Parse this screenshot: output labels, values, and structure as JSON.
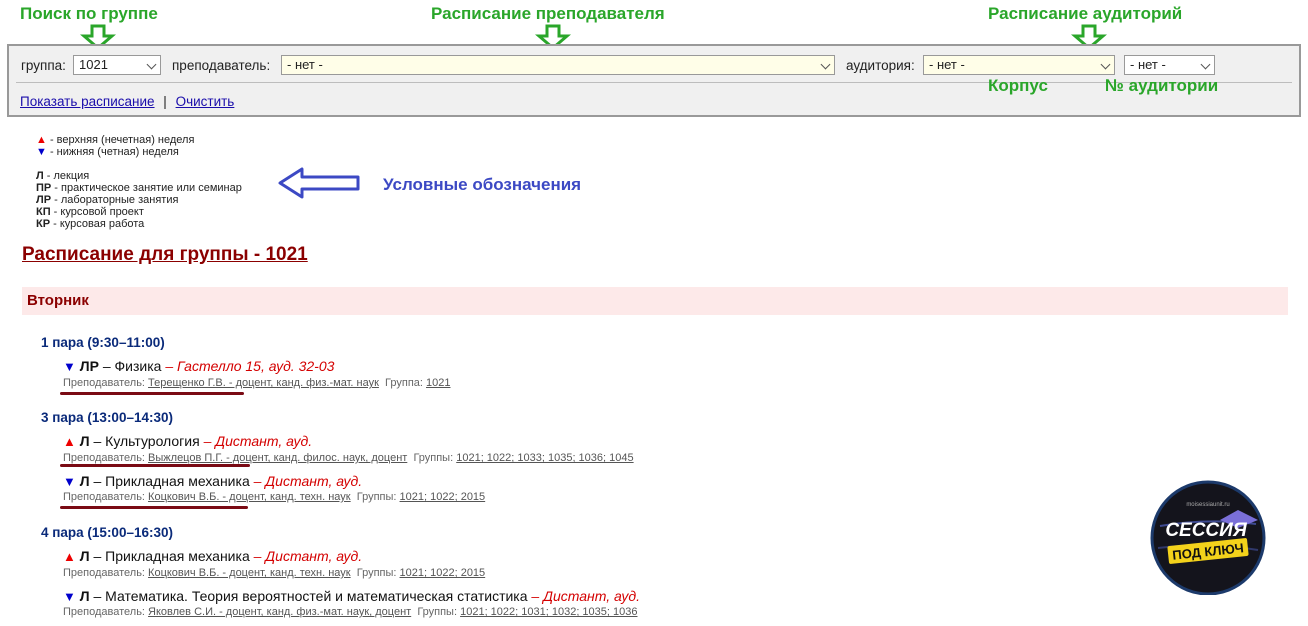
{
  "annotations": {
    "group_search": "Поиск по группе",
    "teacher_schedule": "Расписание преподавателя",
    "rooms_schedule": "Расписание аудиторий",
    "building": "Корпус",
    "room_number": "№ аудитории",
    "legend_note": "Условные обозначения"
  },
  "search": {
    "group_label": "группа:",
    "group_value": "1021",
    "teacher_label": "преподаватель:",
    "teacher_value": "- нет -",
    "room_label": "аудитория:",
    "building_value": "- нет -",
    "room_value": "- нет -",
    "show_link": "Показать расписание",
    "separator": "|",
    "clear_link": "Очистить"
  },
  "legend": {
    "upper_week": "- верхняя (нечетная) неделя",
    "lower_week": "- нижняя (четная) неделя",
    "types": [
      {
        "code": "Л",
        "text": " - лекция"
      },
      {
        "code": "ПР",
        "text": " - практическое занятие или семинар"
      },
      {
        "code": "ЛР",
        "text": " - лабораторные занятия"
      },
      {
        "code": "КП",
        "text": " - курсовой проект"
      },
      {
        "code": "КР",
        "text": " - курсовая работа"
      }
    ]
  },
  "schedule": {
    "title": "Расписание для группы - 1021",
    "day": "Вторник",
    "pairs": [
      {
        "label": "1 пара (9:30–11:00)"
      },
      {
        "label": "3 пара (13:00–14:30)"
      },
      {
        "label": "4 пара (15:00–16:30)"
      }
    ],
    "lessons": [
      {
        "week": "▼",
        "type": "ЛР",
        "subject": " – Физика ",
        "place": "– Гастелло 15, ауд. 32-03",
        "teacher_prefix": "Преподаватель: ",
        "teacher": "Терещенко Г.В. - доцент, канд. физ.-мат. наук",
        "groups_label": "Группа:",
        "groups": "1021"
      },
      {
        "week": "▲",
        "type": "Л",
        "subject": " – Культурология ",
        "place": "– Дистант, ауд.",
        "teacher_prefix": "Преподаватель: ",
        "teacher": "Выжлецов П.Г. - доцент, канд. филос. наук, доцент",
        "groups_label": "Группы:",
        "groups": "1021; 1022; 1033; 1035; 1036; 1045"
      },
      {
        "week": "▼",
        "type": "Л",
        "subject": " – Прикладная механика ",
        "place": "– Дистант, ауд.",
        "teacher_prefix": "Преподаватель: ",
        "teacher": "Коцкович В.Б. - доцент, канд. техн. наук",
        "groups_label": "Группы:",
        "groups": "1021; 1022; 2015"
      },
      {
        "week": "▲",
        "type": "Л",
        "subject": " – Прикладная механика ",
        "place": "– Дистант, ауд.",
        "teacher_prefix": "Преподаватель: ",
        "teacher": "Коцкович В.Б. - доцент, канд. техн. наук",
        "groups_label": "Группы:",
        "groups": "1021; 1022; 2015"
      },
      {
        "week": "▼",
        "type": "Л",
        "subject": " – Математика. Теория вероятностей и математическая статистика ",
        "place": "– Дистант, ауд.",
        "teacher_prefix": "Преподаватель: ",
        "teacher": "Яковлев С.И. - доцент, канд. физ.-мат. наук, доцент",
        "groups_label": "Группы:",
        "groups": "1021; 1022; 1031; 1032; 1035; 1036"
      }
    ]
  },
  "logo": {
    "line1": "СЕССИЯ",
    "line2": "ПОД КЛЮЧ",
    "site": "moisessiaunit.ru"
  },
  "colors": {
    "annotation_green": "#2aa62a",
    "annotation_blue": "#3c49c4",
    "title_red": "#8b0000",
    "place_red": "#d40000"
  }
}
